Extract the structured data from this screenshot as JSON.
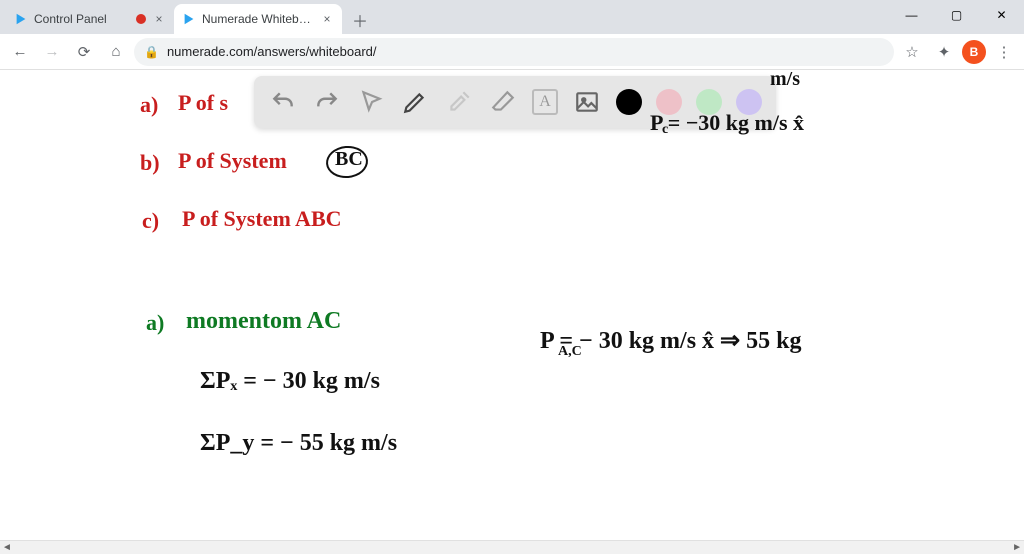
{
  "tabs": [
    {
      "label": "Control Panel",
      "has_badge": true
    },
    {
      "label": "Numerade Whiteboard",
      "has_badge": false
    }
  ],
  "window": {
    "newtab": "＋",
    "min": "—",
    "max": "▢",
    "close": "✕"
  },
  "nav": {
    "back": "←",
    "forward": "→",
    "reload": "⟳",
    "home": "⌂",
    "url": "numerade.com/answers/whiteboard/",
    "star": "☆",
    "ext": "✦",
    "avatar_letter": "B",
    "menu": "⋮"
  },
  "toolbar": {
    "undo": "undo",
    "redo": "redo",
    "pointer": "pointer",
    "pen": "pen",
    "tools": "tools",
    "eraser": "eraser",
    "text": "A",
    "image": "image",
    "swatches": [
      "black",
      "pink",
      "green",
      "purple"
    ]
  },
  "writing": {
    "a_prefix": "a)",
    "a_line": "P  of   s",
    "b_prefix": "b)",
    "b_line": "P  of   System",
    "b_tag": "BC",
    "c_prefix": "c)",
    "c_line": "P  of   System  ABC",
    "ans_a_prefix": "a)",
    "ans_a_title": "momentom    AC",
    "sum_px": "ΣPₓ = − 30 kg m/s",
    "sum_py": "ΣP_y = − 55 kg m/s",
    "top_ms": "m/s",
    "pc_line": "P  = −30  kg m/s  x̂",
    "pc_sub": "c",
    "pac": "P     = − 30 kg m/s  x̂  ⇒ 55 kg",
    "pac_sub": "A,C"
  },
  "scroll": {
    "left": "◄",
    "right": "►"
  }
}
